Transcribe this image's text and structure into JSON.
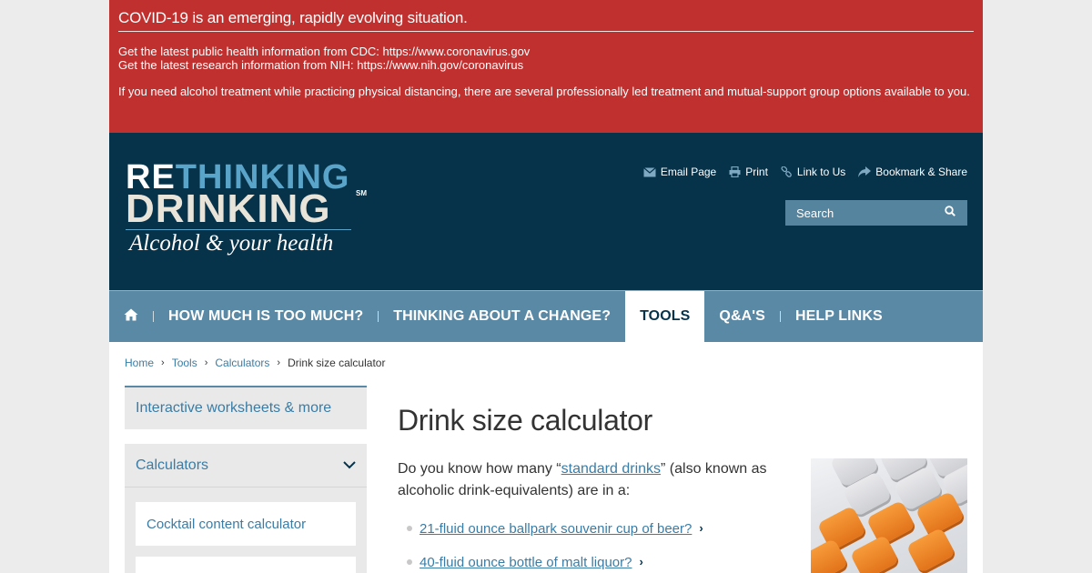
{
  "alert": {
    "title": "COVID-19 is an emerging, rapidly evolving situation.",
    "cdc_line": "Get the latest public health information from CDC: https://www.coronavirus.gov",
    "nih_line": "Get the latest research information from NIH: https://www.nih.gov/coronavirus",
    "treatment_line": "If you need alcohol treatment while practicing physical distancing, there are several professionally led treatment and mutual-support group options available to you."
  },
  "logo": {
    "re": "RE",
    "thinking": "THINKING",
    "drinking": "DRINKING",
    "sm": "SM",
    "tagline": "Alcohol & your health"
  },
  "utilities": {
    "email": "Email Page",
    "print": "Print",
    "link": "Link to Us",
    "bookmark": "Bookmark & Share"
  },
  "search": {
    "placeholder": "Search"
  },
  "nav": {
    "items": [
      {
        "label": "HOW MUCH IS TOO MUCH?"
      },
      {
        "label": "THINKING ABOUT A CHANGE?"
      },
      {
        "label": "TOOLS"
      },
      {
        "label": "Q&A'S"
      },
      {
        "label": "HELP LINKS"
      }
    ]
  },
  "breadcrumb": {
    "home": "Home",
    "tools": "Tools",
    "calculators": "Calculators",
    "current": "Drink size calculator"
  },
  "sidebar": {
    "worksheets": "Interactive worksheets & more",
    "calculators": "Calculators",
    "cocktail": "Cocktail content calculator"
  },
  "main": {
    "title": "Drink size calculator",
    "intro_before": "Do you know how many “",
    "intro_link": "standard drinks",
    "intro_after": "” (also known as alcoholic drink-equivalents) are in a:",
    "list": [
      "21-fluid ounce ballpark souvenir cup of beer?",
      "40-fluid ounce bottle of malt liquor?"
    ]
  },
  "colors": {
    "alert_red": "#c0302f",
    "header_navy": "#06324a",
    "nav_blue": "#5a89a6",
    "link_blue": "#3a7ca5",
    "key_orange": "#f08a2a"
  }
}
